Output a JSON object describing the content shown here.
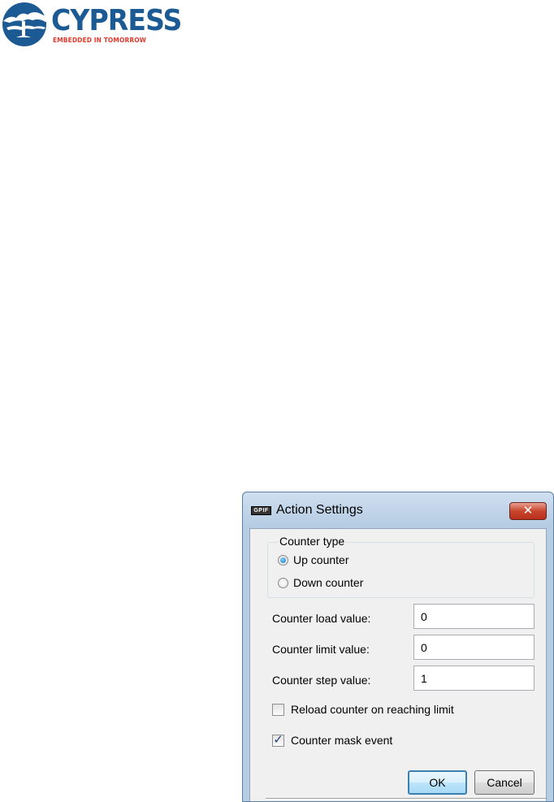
{
  "logo": {
    "wordmark": "CYPRESS",
    "tagline": "EMBEDDED IN TOMORROW",
    "registered": "®"
  },
  "dialog": {
    "icon_label": "GPIF",
    "title": "Action Settings",
    "close_glyph": "✕",
    "counter_type": {
      "title": "Counter type",
      "options": [
        {
          "label": "Up counter",
          "checked": true
        },
        {
          "label": "Down counter",
          "checked": false
        }
      ]
    },
    "fields": {
      "load": {
        "label": "Counter load value:",
        "value": "0"
      },
      "limit": {
        "label": "Counter limit value:",
        "value": "0"
      },
      "step": {
        "label": "Counter step value:",
        "value": "1"
      }
    },
    "checkboxes": {
      "reload": {
        "label": "Reload counter on reaching limit",
        "checked": false
      },
      "mask": {
        "label": "Counter mask event",
        "checked": true,
        "glyph": "✓"
      }
    },
    "buttons": {
      "ok": "OK",
      "cancel": "Cancel"
    }
  },
  "colors": {
    "brand_blue": "#1c5a94",
    "brand_red": "#e23a2c",
    "frame_blue": "#b6cde3",
    "close_red": "#c8452e"
  }
}
